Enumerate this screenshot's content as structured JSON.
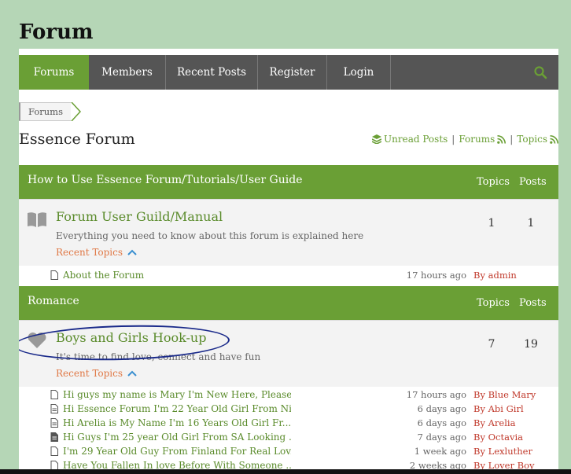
{
  "site": {
    "title": "Forum"
  },
  "nav": {
    "items": [
      "Forums",
      "Members",
      "Recent Posts",
      "Register",
      "Login"
    ],
    "active": "Forums",
    "search_icon": "search-icon"
  },
  "breadcrumb": {
    "items": [
      "Forums"
    ]
  },
  "page": {
    "title": "Essence Forum",
    "links": {
      "unread": "Unread Posts",
      "forums": "Forums",
      "topics": "Topics",
      "separator": "|"
    }
  },
  "colors": {
    "accent": "#6a9f35",
    "nav_bg": "#555555",
    "author": "#c0392b",
    "toggle": "#e07845"
  },
  "categories": [
    {
      "title": "How to Use Essence Forum/Tutorials/User Guide",
      "col_topics": "Topics",
      "col_posts": "Posts",
      "forum": {
        "name": "Forum User Guild/Manual",
        "description": "Everything you need to know about this forum is explained here",
        "recent_label": "Recent Topics",
        "topics": "1",
        "posts": "1",
        "icon": "book-icon"
      },
      "recent_topics": [
        {
          "title": "About the Forum",
          "time": "17 hours ago",
          "by": "By admin"
        }
      ]
    },
    {
      "title": "Romance",
      "col_topics": "Topics",
      "col_posts": "Posts",
      "forum": {
        "name": "Boys and Girls Hook-up",
        "description": "It's time to find love, connect and have fun",
        "recent_label": "Recent Topics",
        "topics": "7",
        "posts": "19",
        "icon": "heart-icon"
      },
      "recent_topics": [
        {
          "title": "Hi guys my name is Mary I'm New Here, Please ...",
          "time": "17 hours ago",
          "by": "By Blue Mary"
        },
        {
          "title": "Hi Essence Forum I'm 22 Year Old Girl From Ni...",
          "time": "6 days ago",
          "by": "By Abi Girl"
        },
        {
          "title": "Hi Arelia is My Name I'm 16 Years Old Girl Fr...",
          "time": "6 days ago",
          "by": "By Arelia"
        },
        {
          "title": "Hi Guys I'm 25 year Old Girl From SA Looking ...",
          "time": "7 days ago",
          "by": "By Octavia"
        },
        {
          "title": "I'm 29 Year Old Guy From Finland For Real Lov...",
          "time": "1 week ago",
          "by": "By Lexluther"
        },
        {
          "title": "Have You Fallen In love Before With Someone ...",
          "time": "2 weeks ago",
          "by": "By Lover Boy"
        }
      ]
    }
  ]
}
